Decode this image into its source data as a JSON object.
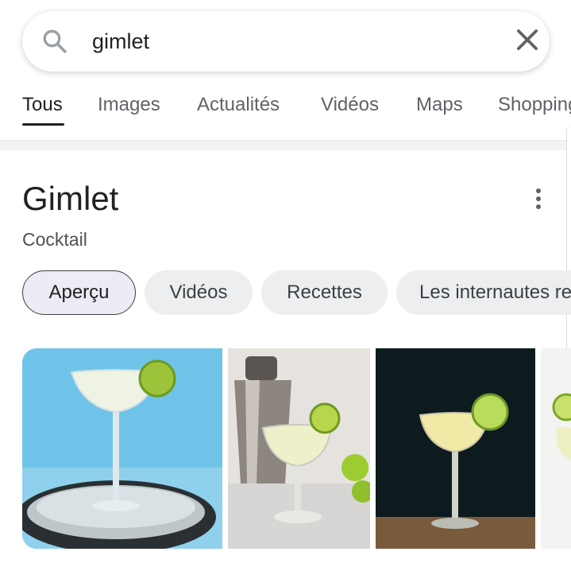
{
  "search": {
    "query": "gimlet",
    "icon": "search-icon",
    "clear_icon": "close-icon"
  },
  "tabs": [
    {
      "label": "Tous"
    },
    {
      "label": "Images"
    },
    {
      "label": "Actualités"
    },
    {
      "label": "Vidéos"
    },
    {
      "label": "Maps"
    },
    {
      "label": "Shopping"
    }
  ],
  "knowledge_panel": {
    "title": "Gimlet",
    "subtitle": "Cocktail",
    "menu_icon": "more-vert-icon",
    "chips": [
      {
        "label": "Aperçu"
      },
      {
        "label": "Vidéos"
      },
      {
        "label": "Recettes"
      },
      {
        "label": "Les internautes recherchent aussi"
      }
    ]
  },
  "colors": {
    "accent": "#202124",
    "chip_bg": "#eceef0",
    "inactive_tab": "#5f6368"
  }
}
